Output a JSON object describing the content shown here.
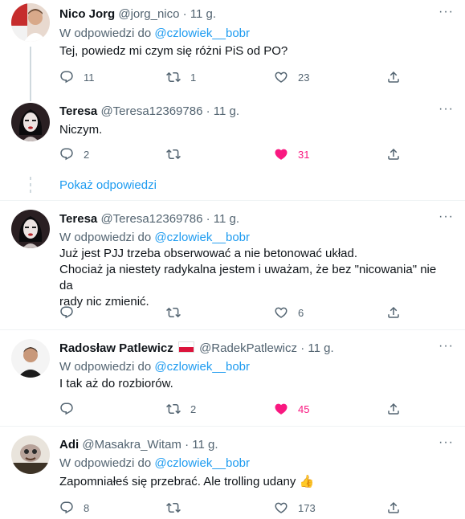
{
  "tweets": [
    {
      "name": "Nico Jorg",
      "handle": "@jorg_nico",
      "time": "11 g.",
      "reply_prefix": "W odpowiedzi do",
      "reply_mention": "@czlowiek__bobr",
      "text": "Tej, powiedz mi czym się różni PiS od PO?",
      "replies": "11",
      "retweets": "1",
      "likes": "23"
    },
    {
      "name": "Teresa",
      "handle": "@Teresa12369786",
      "time": "11 g.",
      "text": "Niczym.",
      "replies": "2",
      "retweets": "",
      "likes": "31",
      "liked": true
    },
    {
      "name": "Teresa",
      "handle": "@Teresa12369786",
      "time": "11 g.",
      "reply_prefix": "W odpowiedzi do",
      "reply_mention": "@czlowiek__bobr",
      "text_lines": [
        "Już jest PJJ trzeba obserwować a nie betonować układ.",
        "Chociaż ja niestety radykalna jestem i uważam, że bez \"nicowania\" nie da",
        "rady nic zmienić."
      ],
      "replies": "",
      "retweets": "",
      "likes": "6"
    },
    {
      "name": "Radosław Patlewicz",
      "handle": "@RadekPatlewicz",
      "time": "11 g.",
      "reply_prefix": "W odpowiedzi do",
      "reply_mention": "@czlowiek__bobr",
      "text": "I tak aż do rozbiorów.",
      "replies": "",
      "retweets": "2",
      "likes": "45",
      "liked": true
    },
    {
      "name": "Adi",
      "handle": "@Masakra_Witam",
      "time": "11 g.",
      "reply_prefix": "W odpowiedzi do",
      "reply_mention": "@czlowiek__bobr",
      "text": "Zapomniałeś się przebrać. Ale trolling udany",
      "emoji": "👍",
      "replies": "8",
      "retweets": "",
      "likes": "173"
    }
  ],
  "show_replies": "Pokaż odpowiedzi",
  "more_glyph": "···",
  "dot": "·",
  "colors": {
    "accent": "#1d9bf0",
    "like": "#f91880",
    "muted": "#536471",
    "text": "#0f1419"
  },
  "icons": {
    "reply": "reply-icon",
    "retweet": "retweet-icon",
    "like": "heart-icon",
    "share": "share-icon",
    "more": "more-icon"
  }
}
